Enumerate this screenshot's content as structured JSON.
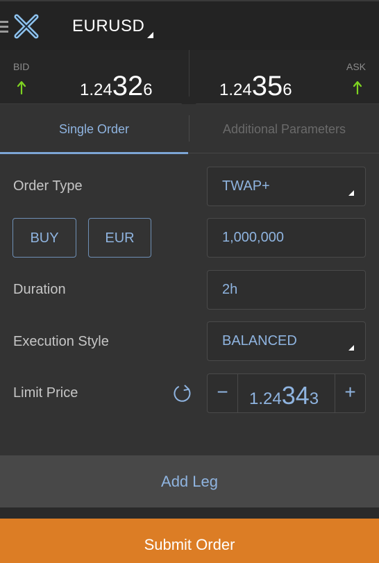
{
  "header": {
    "symbol": "EURUSD",
    "menu_icon": "hamburger-menu-icon",
    "logo_icon": "x-logo-icon"
  },
  "prices": {
    "bid": {
      "label": "BID",
      "prefix": "1.24",
      "big": "32",
      "suffix": "6",
      "direction": "up"
    },
    "ask": {
      "label": "ASK",
      "prefix": "1.24",
      "big": "35",
      "suffix": "6",
      "direction": "up"
    }
  },
  "tabs": [
    {
      "label": "Single Order",
      "active": true
    },
    {
      "label": "Additional Parameters",
      "active": false
    }
  ],
  "form": {
    "order_type": {
      "label": "Order Type",
      "value": "TWAP+"
    },
    "side": "BUY",
    "currency": "EUR",
    "amount": "1,000,000",
    "duration": {
      "label": "Duration",
      "value": "2h"
    },
    "execution_style": {
      "label": "Execution Style",
      "value": "BALANCED"
    },
    "limit_price": {
      "label": "Limit Price",
      "prefix": "1.24",
      "big": "34",
      "suffix": "3",
      "minus": "−",
      "plus": "+"
    }
  },
  "actions": {
    "add_leg": "Add Leg",
    "submit": "Submit Order"
  },
  "colors": {
    "accent": "#8fb4e0",
    "up_arrow": "#7ed321",
    "submit": "#dc7d25"
  }
}
